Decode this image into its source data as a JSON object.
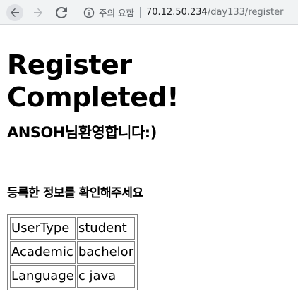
{
  "browser": {
    "security_label": "주의 요함",
    "url_host": "70.12.50.234",
    "url_path": "/day133/register"
  },
  "page": {
    "heading": "Register Completed!",
    "welcome": "ANSOH님환영합니다:)",
    "confirm_prompt": "등록한 정보를 확인해주세요",
    "rows": [
      {
        "label": "UserType",
        "value": "student"
      },
      {
        "label": "Academic",
        "value": "bachelor"
      },
      {
        "label": "Language",
        "value": "c java"
      }
    ]
  },
  "colors": {
    "toolbar_bg": "#f1f3f4",
    "table_border": "#808080"
  }
}
